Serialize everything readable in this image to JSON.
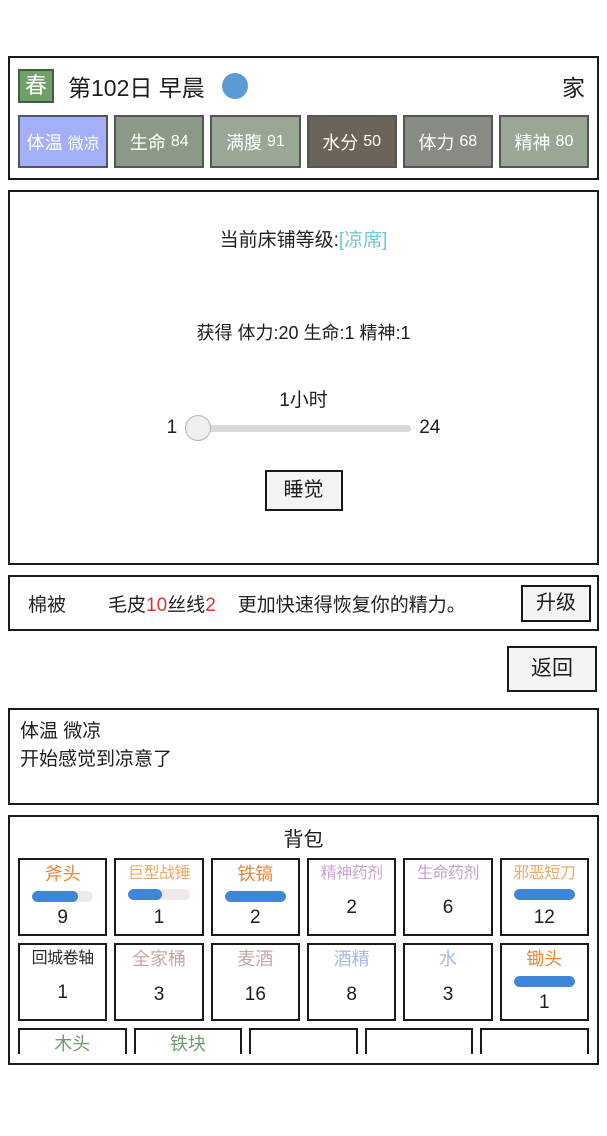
{
  "header": {
    "season": "春",
    "season_bg": "#6fa06a",
    "day_text": "第102日 早晨",
    "weather_icon": "blue-circle",
    "weather_color": "#5b9bd5",
    "location": "家",
    "stats": [
      {
        "label": "体温",
        "value": "微凉",
        "bg": "#a3b0f7"
      },
      {
        "label": "生命",
        "value": "84",
        "bg": "#8b9a86"
      },
      {
        "label": "满腹",
        "value": "91",
        "bg": "#9aa795"
      },
      {
        "label": "水分",
        "value": "50",
        "bg": "#6b6458"
      },
      {
        "label": "体力",
        "value": "68",
        "bg": "#868b83"
      },
      {
        "label": "精神",
        "value": "80",
        "bg": "#9aa795"
      }
    ]
  },
  "bed": {
    "level_prefix": "当前床铺等级:",
    "level_name": "[凉席]",
    "level_color": "#72c7d4",
    "gain_text": "获得 体力:20  生命:1  精神:1",
    "slider": {
      "label": "1小时",
      "min": "1",
      "max": "24",
      "value": 1
    },
    "sleep_button": "睡觉"
  },
  "upgrade": {
    "name": "棉被",
    "cost_mat1": "毛皮",
    "cost_num1": "10",
    "cost_mat2": "丝线",
    "cost_num2": "2",
    "description": "更加快速得恢复你的精力。",
    "button": "升级",
    "cost_color": "#e03131"
  },
  "back_button": "返回",
  "log": {
    "line1": "体温 微凉",
    "line2": "开始感觉到凉意了"
  },
  "backpack": {
    "title": "背包",
    "rows": [
      [
        {
          "name": "斧头",
          "count": "9",
          "color": "#e8863a",
          "bar": 75
        },
        {
          "name": "巨型战锤",
          "count": "1",
          "color": "#e8a96a",
          "bar": 55,
          "squeeze": true
        },
        {
          "name": "铁镐",
          "count": "2",
          "color": "#e8863a",
          "bar": 100
        },
        {
          "name": "精神药剂",
          "count": "2",
          "color": "#c9a4d4",
          "bar": -1,
          "squeeze": true
        },
        {
          "name": "生命药剂",
          "count": "6",
          "color": "#c4a0cf",
          "bar": -1,
          "squeeze": true
        },
        {
          "name": "邪恶短刀",
          "count": "12",
          "color": "#e8a96a",
          "bar": 100,
          "squeeze": true
        }
      ],
      [
        {
          "name": "回城卷轴",
          "count": "1",
          "color": "#2b2b2b",
          "bar": -1,
          "squeeze": true
        },
        {
          "name": "全家桶",
          "count": "3",
          "color": "#c9a6a6",
          "bar": -1
        },
        {
          "name": "麦酒",
          "count": "16",
          "color": "#c9a6a6",
          "bar": -1
        },
        {
          "name": "酒精",
          "count": "8",
          "color": "#aab6e8",
          "bar": -1
        },
        {
          "name": "水",
          "count": "3",
          "color": "#aab6e8",
          "bar": -1
        },
        {
          "name": "锄头",
          "count": "1",
          "color": "#e8863a",
          "bar": 100
        }
      ],
      [
        {
          "name": "木头",
          "count": "",
          "color": "#6f9a6f",
          "bar": -1
        },
        {
          "name": "铁块",
          "count": "",
          "color": "#6f9a6f",
          "bar": -1
        },
        {
          "name": "",
          "count": "",
          "color": "#6f9a6f",
          "bar": -1
        },
        {
          "name": "",
          "count": "",
          "color": "#6f9a6f",
          "bar": -1
        },
        {
          "name": "",
          "count": "",
          "color": "#6f9a6f",
          "bar": -1
        }
      ]
    ]
  }
}
